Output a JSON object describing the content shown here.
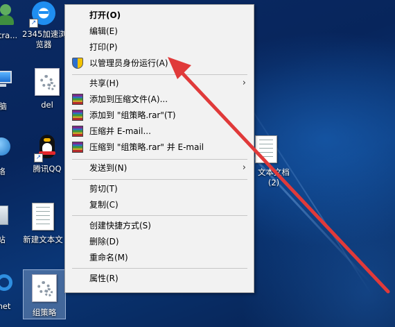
{
  "desktop": {
    "icons": [
      {
        "id": "user-folder",
        "label": "etra..."
      },
      {
        "id": "browser-2345",
        "label_line1": "2345加速浏",
        "label_line2": "览器"
      },
      {
        "id": "this-pc",
        "label": "脑"
      },
      {
        "id": "del",
        "label": "del"
      },
      {
        "id": "network",
        "label": "络"
      },
      {
        "id": "tencent-qq",
        "label": "腾讯QQ"
      },
      {
        "id": "recycle-bin",
        "label": "站"
      },
      {
        "id": "new-text-doc",
        "label": "新建文本文"
      },
      {
        "id": "ie",
        "label": "net"
      },
      {
        "id": "zucelue",
        "label": "组策略"
      },
      {
        "id": "text-doc-2",
        "label_line1": "文本文档",
        "label_line2": "(2)"
      }
    ]
  },
  "context_menu": {
    "open": "打开(O)",
    "edit": "编辑(E)",
    "print": "打印(P)",
    "run_as_admin": "以管理员身份运行(A)",
    "share": "共享(H)",
    "add_to_archive": "添加到压缩文件(A)...",
    "add_to_rar": "添加到 \"组策略.rar\"(T)",
    "compress_email": "压缩并 E-mail...",
    "compress_rar_email": "压缩到 \"组策略.rar\" 并 E-mail",
    "send_to": "发送到(N)",
    "cut": "剪切(T)",
    "copy": "复制(C)",
    "create_shortcut": "创建快捷方式(S)",
    "delete": "删除(D)",
    "rename": "重命名(M)",
    "properties": "属性(R)"
  },
  "colors": {
    "menu_bg": "#f2f2f2",
    "annotation_arrow": "#e03a3a",
    "desktop_bg": "#0a3676"
  }
}
